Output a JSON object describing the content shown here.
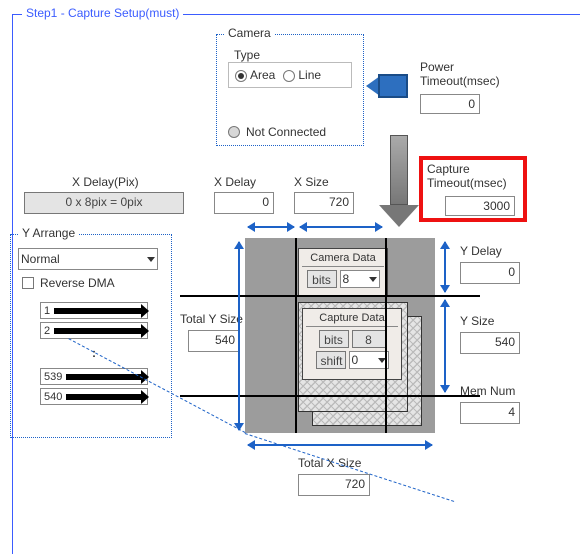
{
  "step_title": "Step1 - Capture Setup(must)",
  "camera": {
    "group_label": "Camera",
    "type_label": "Type",
    "area_label": "Area",
    "line_label": "Line",
    "status_text": "Not Connected"
  },
  "power_timeout": {
    "label": "Power\nTimeout(msec)",
    "value": "0"
  },
  "capture_timeout": {
    "label": "Capture\nTimeout(msec)",
    "value": "3000"
  },
  "x_delay_pix": {
    "label": "X Delay(Pix)",
    "value": "0 x 8pix = 0pix"
  },
  "x_delay": {
    "label": "X Delay",
    "value": "0"
  },
  "x_size": {
    "label": "X Size",
    "value": "720"
  },
  "y_arrange": {
    "group_label": "Y Arrange",
    "select_value": "Normal",
    "reverse_dma_label": "Reverse DMA",
    "rows_top": [
      "1",
      "2"
    ],
    "rows_divider": ":",
    "rows_bottom": [
      "539",
      "540"
    ]
  },
  "total_y_size": {
    "label": "Total Y Size",
    "value": "540"
  },
  "camera_data": {
    "label": "Camera Data",
    "bits_label": "bits",
    "bits_value": "8"
  },
  "capture_data": {
    "label": "Capture Data",
    "bits_label": "bits",
    "bits_value": "8",
    "shift_label": "shift",
    "shift_value": "0"
  },
  "y_delay": {
    "label": "Y Delay",
    "value": "0"
  },
  "y_size": {
    "label": "Y Size",
    "value": "540"
  },
  "mem_num": {
    "label": "Mem Num",
    "value": "4"
  },
  "total_x_size": {
    "label": "Total X Size",
    "value": "720"
  },
  "colors": {
    "accent_blue": "#1d62c7",
    "highlight_red": "#e11"
  }
}
